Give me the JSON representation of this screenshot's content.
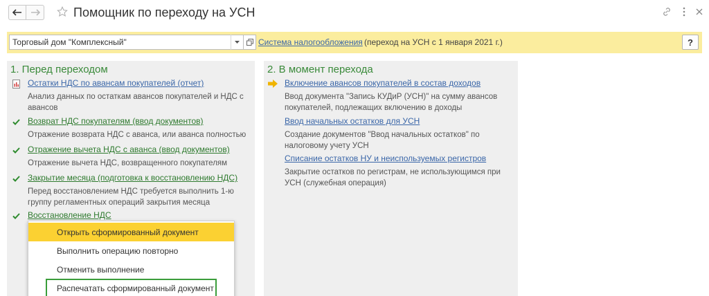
{
  "window": {
    "title": "Помощник по переходу на УСН"
  },
  "params": {
    "organization": "Торговый дом \"Комплексный\"",
    "tax_system_link": "Система налогообложения",
    "transition_note": "(переход на УСН с 1 января 2021 г.)",
    "help_label": "?"
  },
  "before": {
    "title": "1. Перед переходом",
    "steps": [
      {
        "link": "Остатки НДС по авансам покупателей (отчет)",
        "desc": "Анализ данных по остаткам авансов покупателей и НДС с авансов",
        "icon": "report-icon"
      },
      {
        "link": "Возврат НДС покупателям (ввод документов)",
        "desc": "Отражение возврата НДС с аванса, или аванса полностью",
        "icon": "check-icon"
      },
      {
        "link": "Отражение вычета НДС с аванса (ввод документов)",
        "desc": "Отражение вычета НДС, возвращенного покупателям",
        "icon": "check-icon"
      },
      {
        "link": "Закрытие месяца (подготовка к восстановлению НДС)",
        "desc": "Перед восстановлением НДС требуется выполнить 1-ю группу регламентных операций закрытия месяца",
        "icon": "check-icon"
      },
      {
        "link": "Восстановление НДС",
        "desc": "",
        "icon": "check-icon"
      }
    ]
  },
  "at_transition": {
    "title": "2. В момент перехода",
    "steps": [
      {
        "link": "Включение авансов покупателей в состав доходов",
        "desc": "Ввод документа \"Запись КУДиР (УСН)\" на сумму авансов покупателей, подлежащих включению в доходы",
        "icon": "arrow-right-icon"
      },
      {
        "link": "Ввод начальных остатков для УСН",
        "desc": "Создание документов \"Ввод начальных остатков\" по налоговому учету УСН",
        "icon": ""
      },
      {
        "link": "Списание остатков НУ и неиспользуемых регистров",
        "desc": "Закрытие остатков по  регистрам, не использующимся при УСН (служебная операция)",
        "icon": ""
      }
    ]
  },
  "context_menu": {
    "items": [
      "Открыть сформированный документ",
      "Выполнить операцию повторно",
      "Отменить выполнение",
      "Распечатать сформированный документ"
    ]
  },
  "colors": {
    "accent_yellow": "#fbed9e",
    "menu_highlight": "#fbd132",
    "link_blue": "#3a66a8",
    "done_green": "#2e7a2e",
    "title_green": "#3a8a3a",
    "box_green": "#3a9d3a"
  }
}
